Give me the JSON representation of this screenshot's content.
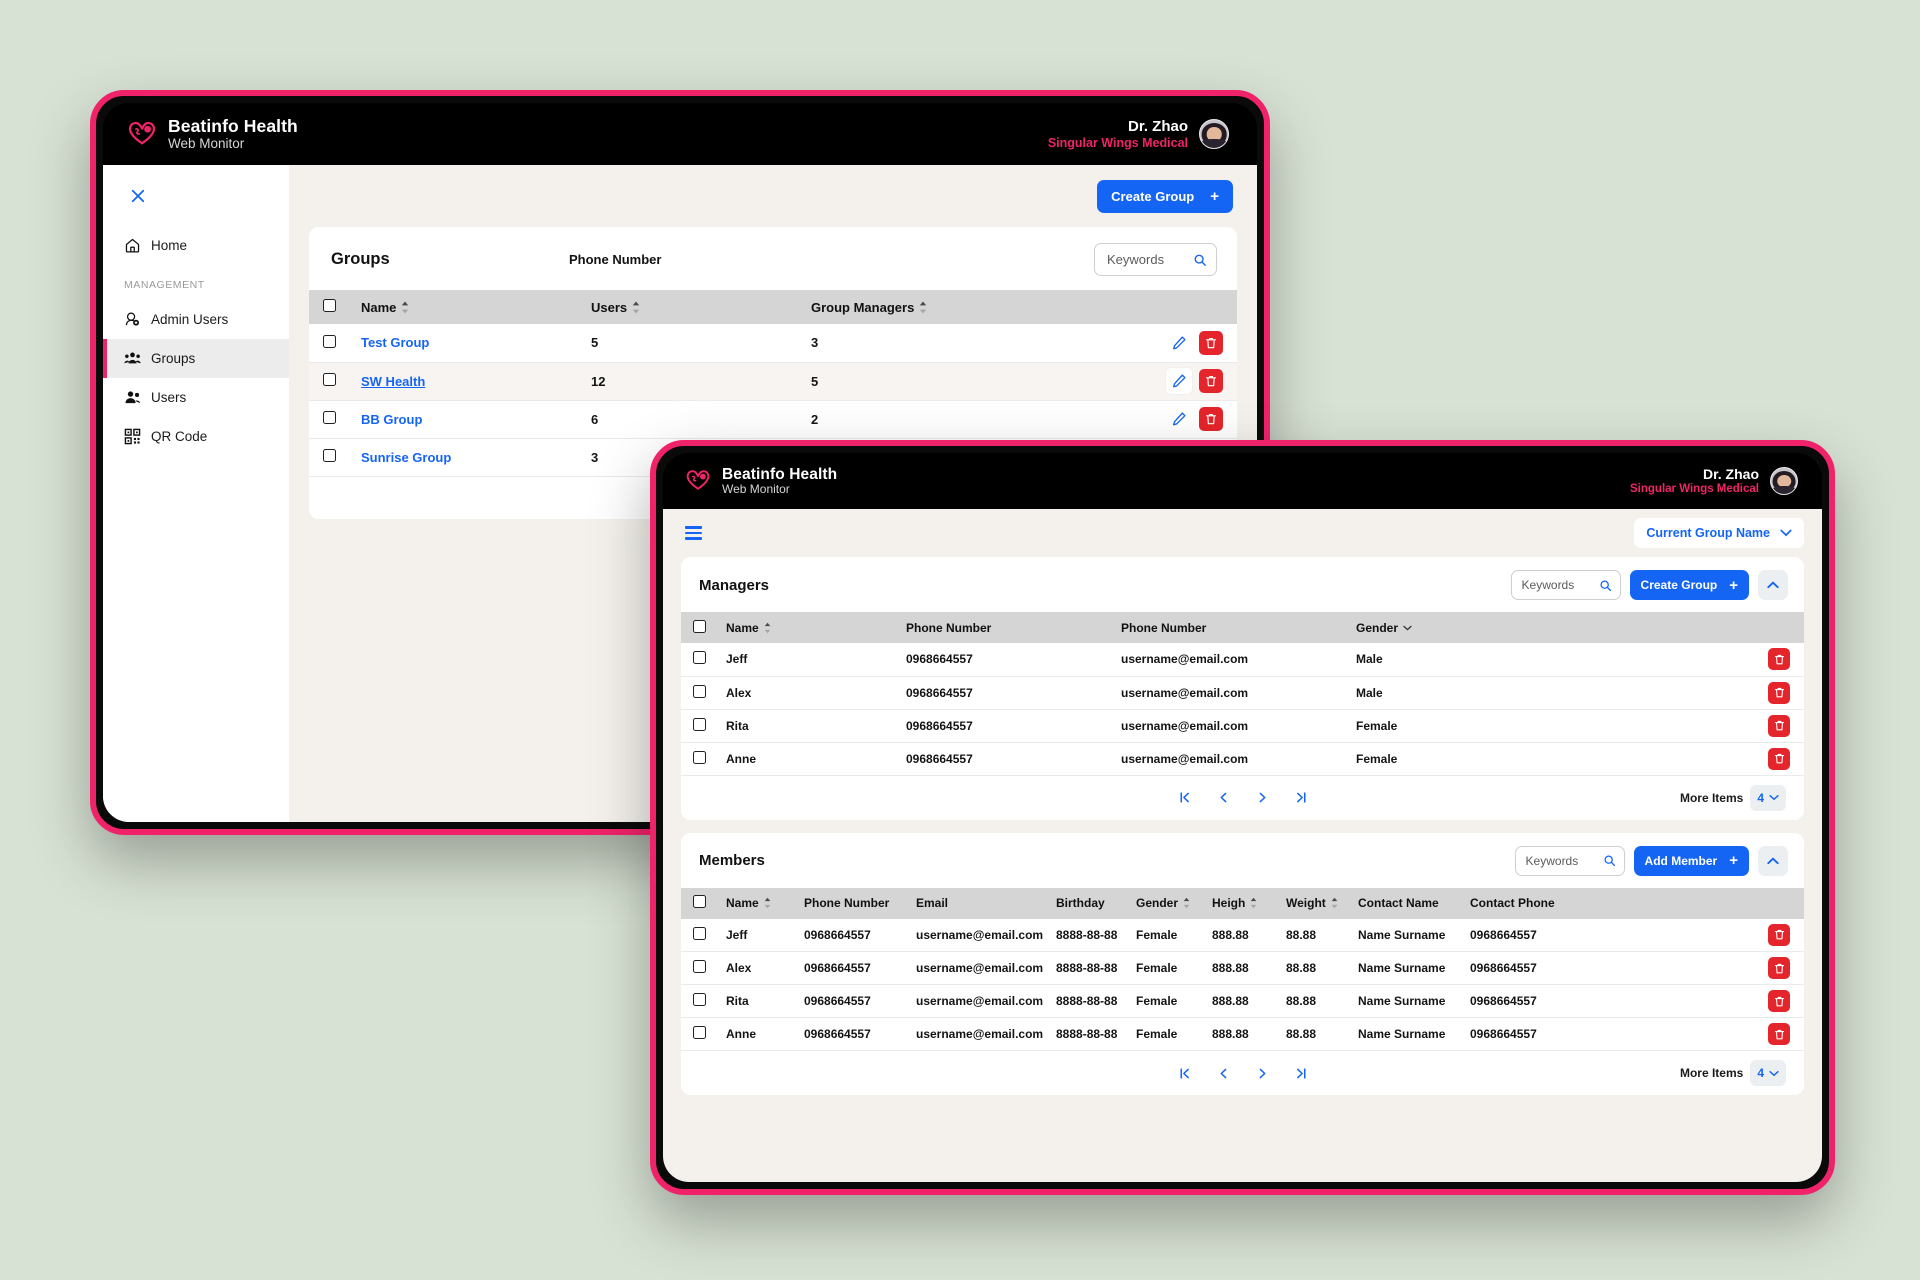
{
  "background_color": "#d8e2d4",
  "accent_pink": "#f0236a",
  "accent_blue": "#1565f5",
  "danger_red": "#e4252b",
  "brand": {
    "title": "Beatinfo Health",
    "subtitle": "Web Monitor",
    "logo_icon": "heart-pulse-logo-icon"
  },
  "user": {
    "name": "Dr. Zhao",
    "org": "Singular Wings Medical",
    "avatar_icon": "avatar"
  },
  "window_one": {
    "sidebar": {
      "close_icon": "close-icon",
      "items": [
        {
          "label": "Home",
          "icon": "home-icon",
          "active": false
        },
        {
          "label": "Admin Users",
          "icon": "admin-user-icon",
          "active": false
        },
        {
          "label": "Groups",
          "icon": "groups-icon",
          "active": true
        },
        {
          "label": "Users",
          "icon": "users-icon",
          "active": false
        },
        {
          "label": "QR Code",
          "icon": "qr-code-icon",
          "active": false
        }
      ],
      "section_label": "MANAGEMENT"
    },
    "toolbar": {
      "create_group_label": "Create Group",
      "plus_icon": "plus-icon"
    },
    "groups_card": {
      "title": "Groups",
      "floating_label": "Phone Number",
      "search_placeholder": "Keywords",
      "search_icon": "search-icon",
      "columns": [
        "Name",
        "Users",
        "Group Managers"
      ],
      "rows": [
        {
          "name": "Test Group",
          "users": "5",
          "managers": "3",
          "underline": false,
          "alt": false,
          "edit_hover": false
        },
        {
          "name": "SW Health",
          "users": "12",
          "managers": "5",
          "underline": true,
          "alt": true,
          "edit_hover": true
        },
        {
          "name": "BB Group",
          "users": "6",
          "managers": "2",
          "underline": false,
          "alt": false,
          "edit_hover": false
        },
        {
          "name": "Sunrise Group",
          "users": "3",
          "managers": "",
          "underline": false,
          "alt": false,
          "edit_hover": false
        }
      ],
      "edit_icon": "pencil-edit-icon",
      "delete_icon": "trash-delete-icon"
    }
  },
  "window_two": {
    "topbar": {
      "menu_icon": "hamburger-menu-icon",
      "group_selector_label": "Current Group Name",
      "chevron_icon": "chevron-down-icon"
    },
    "managers_card": {
      "title": "Managers",
      "search_placeholder": "Keywords",
      "search_icon": "search-icon",
      "create_button_label": "Create Group",
      "collapse_icon": "chevron-up-icon",
      "columns": [
        "Name",
        "Phone Number",
        "Phone Number",
        "Gender"
      ],
      "rows": [
        {
          "name": "Jeff",
          "phone": "0968664557",
          "email": "username@email.com",
          "gender": "Male"
        },
        {
          "name": "Alex",
          "phone": "0968664557",
          "email": "username@email.com",
          "gender": "Male"
        },
        {
          "name": "Rita",
          "phone": "0968664557",
          "email": "username@email.com",
          "gender": "Female"
        },
        {
          "name": "Anne",
          "phone": "0968664557",
          "email": "username@email.com",
          "gender": "Female"
        }
      ],
      "delete_icon": "trash-delete-icon",
      "pagination": {
        "first_icon": "first-page-icon",
        "prev_icon": "prev-page-icon",
        "next_icon": "next-page-icon",
        "last_icon": "last-page-icon",
        "more_items_label": "More Items",
        "page_size": "4"
      }
    },
    "members_card": {
      "title": "Members",
      "search_placeholder": "Keywords",
      "search_icon": "search-icon",
      "add_button_label": "Add Member",
      "collapse_icon": "chevron-up-icon",
      "columns": [
        "Name",
        "Phone Number",
        "Email",
        "Birthday",
        "Gender",
        "Heigh",
        "Weight",
        "Contact Name",
        "Contact Phone"
      ],
      "rows": [
        {
          "name": "Jeff",
          "phone": "0968664557",
          "email": "username@email.com",
          "birthday": "8888-88-88",
          "gender": "Female",
          "heigh": "888.88",
          "weight": "88.88",
          "contact_name": "Name Surname",
          "contact_phone": "0968664557"
        },
        {
          "name": "Alex",
          "phone": "0968664557",
          "email": "username@email.com",
          "birthday": "8888-88-88",
          "gender": "Female",
          "heigh": "888.88",
          "weight": "88.88",
          "contact_name": "Name Surname",
          "contact_phone": "0968664557"
        },
        {
          "name": "Rita",
          "phone": "0968664557",
          "email": "username@email.com",
          "birthday": "8888-88-88",
          "gender": "Female",
          "heigh": "888.88",
          "weight": "88.88",
          "contact_name": "Name Surname",
          "contact_phone": "0968664557"
        },
        {
          "name": "Anne",
          "phone": "0968664557",
          "email": "username@email.com",
          "birthday": "8888-88-88",
          "gender": "Female",
          "heigh": "888.88",
          "weight": "88.88",
          "contact_name": "Name Surname",
          "contact_phone": "0968664557"
        }
      ],
      "delete_icon": "trash-delete-icon",
      "pagination": {
        "first_icon": "first-page-icon",
        "prev_icon": "prev-page-icon",
        "next_icon": "next-page-icon",
        "last_icon": "last-page-icon",
        "more_items_label": "More Items",
        "page_size": "4"
      }
    }
  }
}
